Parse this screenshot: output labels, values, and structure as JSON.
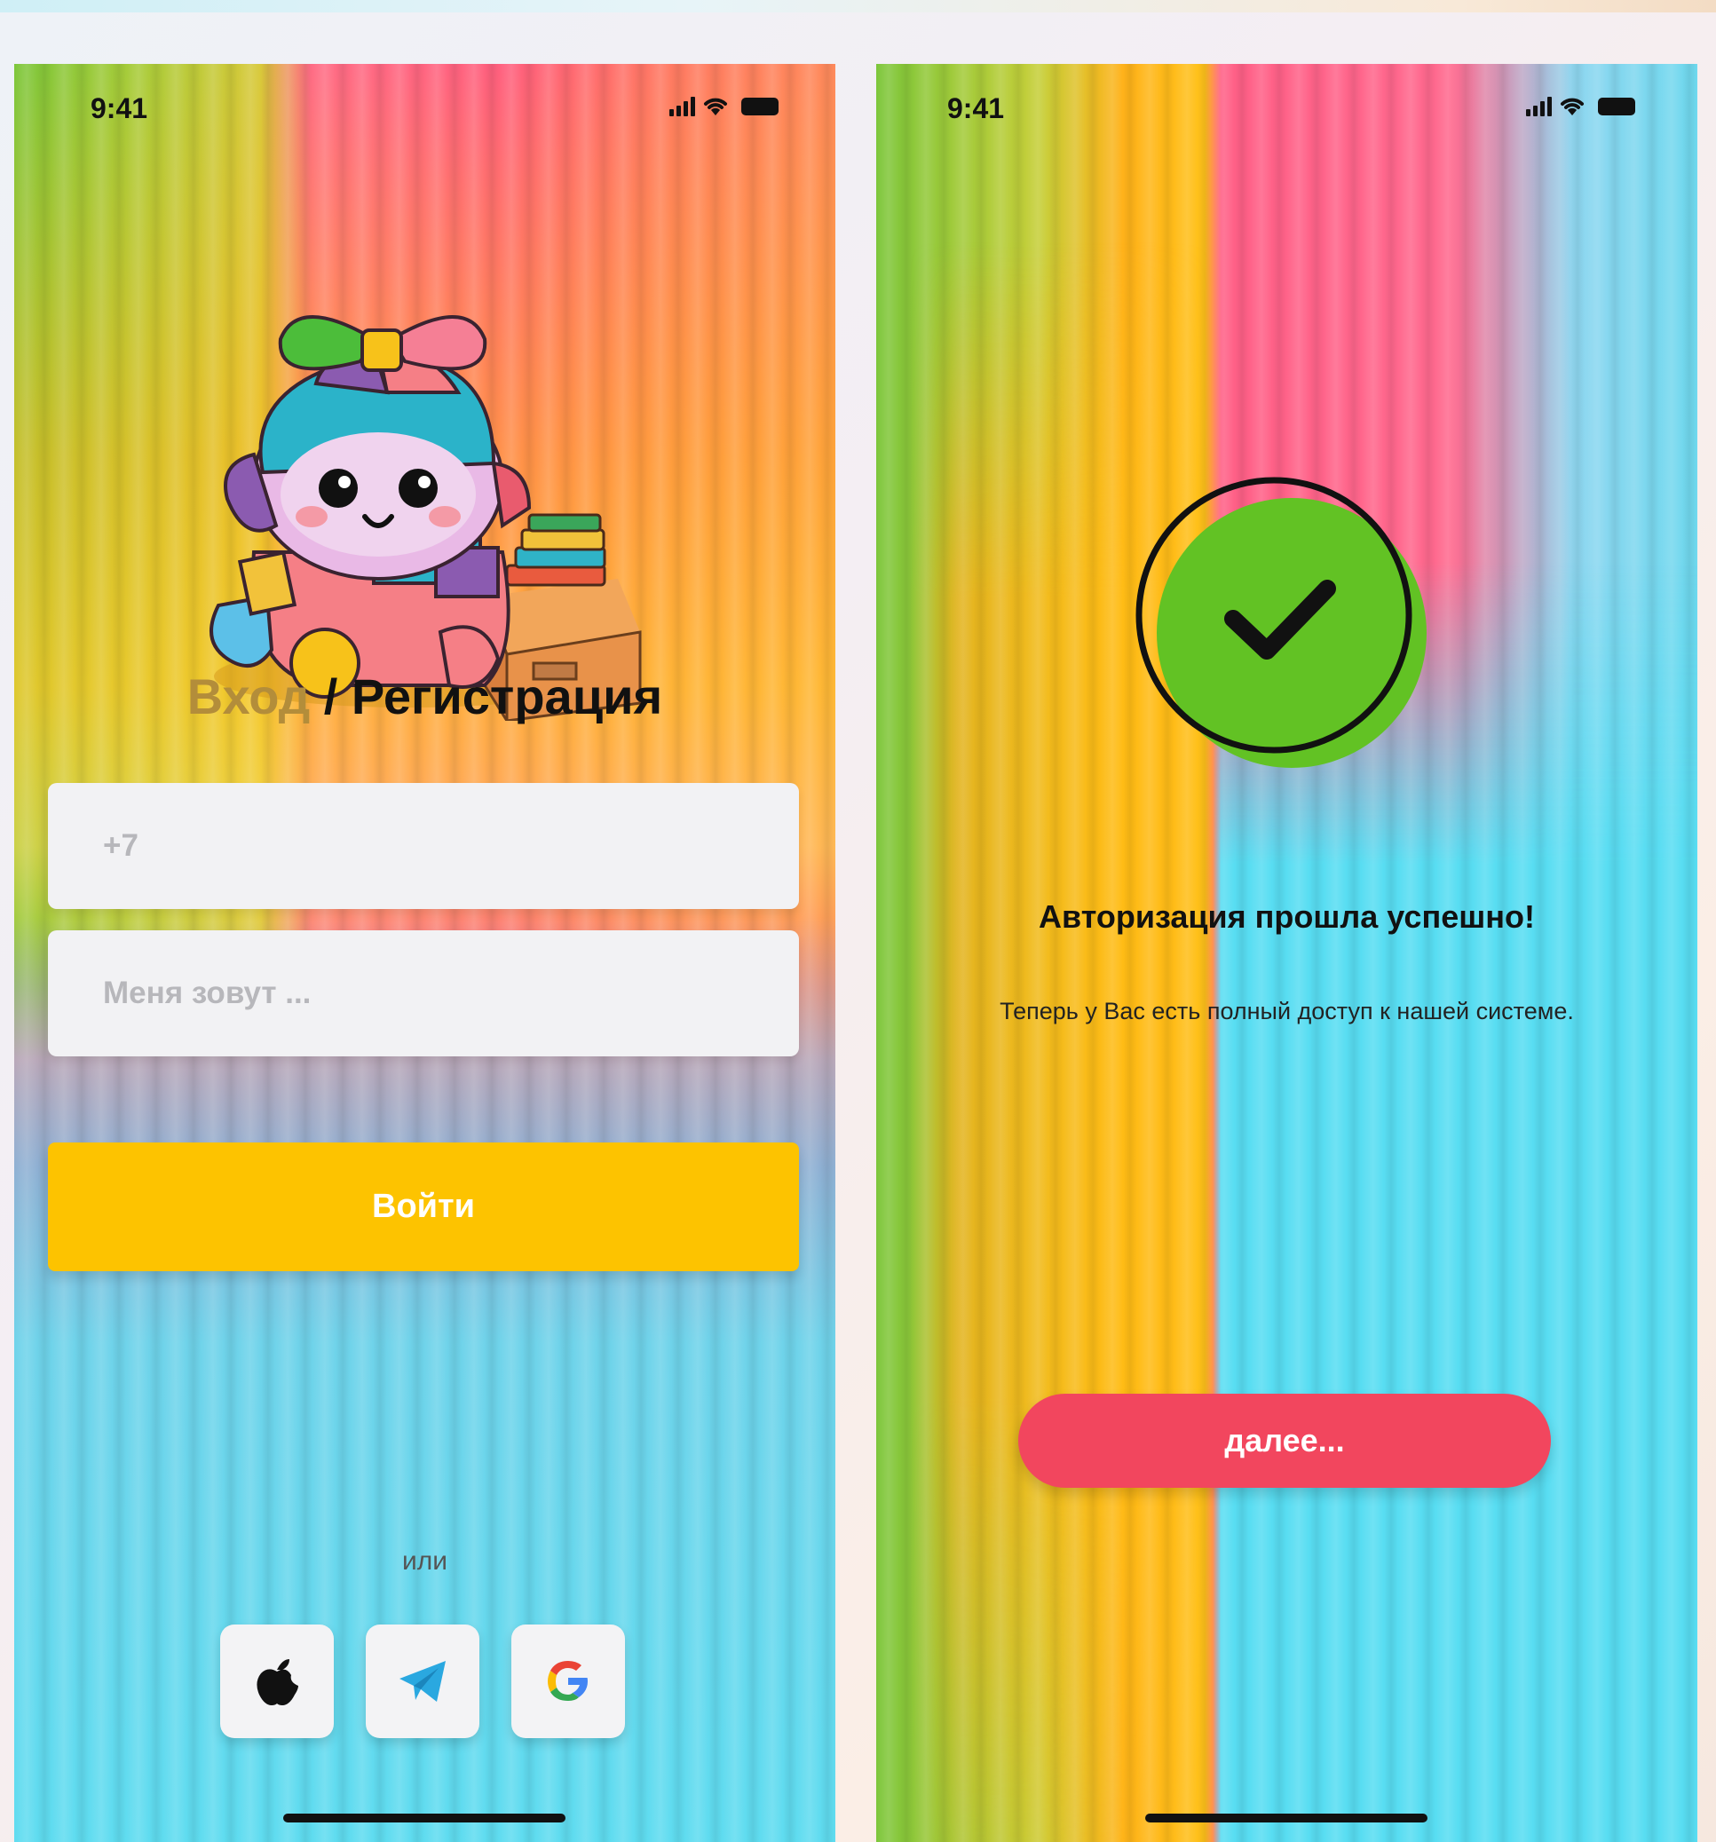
{
  "left_screen": {
    "status_time": "9:41",
    "title_login": "Вход",
    "title_separator": "/",
    "title_register": "Регистрация",
    "phone_placeholder": "+7",
    "name_placeholder": "Меня зовут ...",
    "login_button": "Войти",
    "or_label": "или",
    "social": [
      "apple-icon",
      "telegram-icon",
      "google-icon"
    ]
  },
  "right_screen": {
    "status_time": "9:41",
    "success_title": "Авторизация прошла успешно!",
    "success_message": "Теперь у Вас есть полный доступ к нашей системе.",
    "next_button": "далее..."
  },
  "colors": {
    "login_button": "#fdc300",
    "next_button": "#f2465e",
    "check_circle": "#62c224"
  }
}
